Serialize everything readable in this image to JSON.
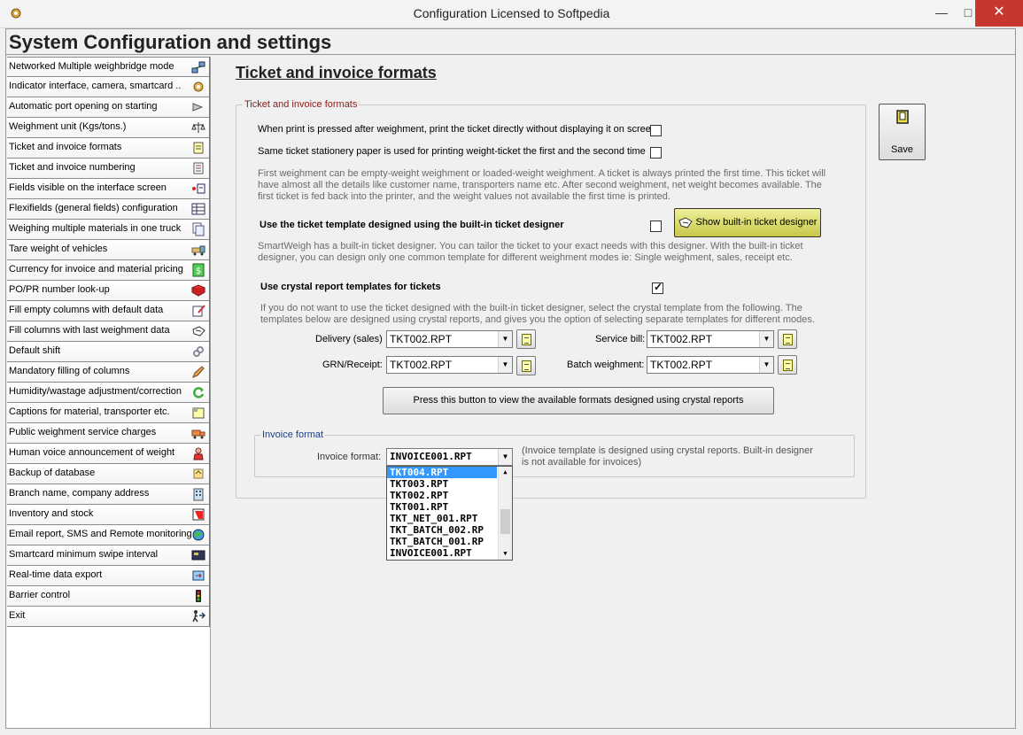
{
  "window": {
    "title": "Configuration  Licensed to Softpedia",
    "minimize": "—",
    "maximize": "□",
    "close": "✕"
  },
  "header": {
    "heading": "System Configuration and settings"
  },
  "sidebar": {
    "items": [
      {
        "label": "Networked Multiple weighbridge mode",
        "icon": "network-icon"
      },
      {
        "label": "Indicator interface, camera, smartcard ..",
        "icon": "gear-icon"
      },
      {
        "label": "Automatic port opening on starting",
        "icon": "plug-icon"
      },
      {
        "label": "Weighment unit (Kgs/tons.)",
        "icon": "scale-icon"
      },
      {
        "label": "Ticket and invoice formats",
        "icon": "document-icon"
      },
      {
        "label": "Ticket and invoice numbering",
        "icon": "numbered-document-icon"
      },
      {
        "label": "Fields visible on the interface screen",
        "icon": "screen-fields-icon"
      },
      {
        "label": "Flexifields (general fields) configuration",
        "icon": "table-icon"
      },
      {
        "label": "Weighing multiple materials in one truck",
        "icon": "documents-icon"
      },
      {
        "label": "Tare weight of vehicles",
        "icon": "truck-icon"
      },
      {
        "label": "Currency for invoice and material pricing",
        "icon": "currency-icon"
      },
      {
        "label": "PO/PR number look-up",
        "icon": "book-icon"
      },
      {
        "label": "Fill empty columns with default data",
        "icon": "edit-icon"
      },
      {
        "label": "Fill columns with last weighment data",
        "icon": "hand-icon"
      },
      {
        "label": "Default shift",
        "icon": "link-icon"
      },
      {
        "label": "Mandatory filling of columns",
        "icon": "pencil-icon"
      },
      {
        "label": "Humidity/wastage adjustment/correction",
        "icon": "refresh-icon"
      },
      {
        "label": "Captions for material, transporter etc.",
        "icon": "caption-icon"
      },
      {
        "label": "Public weighment service charges",
        "icon": "delivery-truck-icon"
      },
      {
        "label": "Human voice announcement of weight",
        "icon": "person-icon"
      },
      {
        "label": "Backup of database",
        "icon": "backup-icon"
      },
      {
        "label": "Branch name, company address",
        "icon": "building-icon"
      },
      {
        "label": "Inventory and stock",
        "icon": "stock-icon"
      },
      {
        "label": "Email report, SMS and Remote monitoring",
        "icon": "globe-icon"
      },
      {
        "label": "Smartcard minimum swipe interval",
        "icon": "card-icon"
      },
      {
        "label": "Real-time data export",
        "icon": "export-icon"
      },
      {
        "label": "Barrier control",
        "icon": "traffic-light-icon"
      },
      {
        "label": "Exit",
        "icon": "exit-icon"
      }
    ]
  },
  "main": {
    "section_title": "Ticket and invoice formats",
    "ticket_group": {
      "legend": "Ticket and invoice formats",
      "print_directly_label": "When print is pressed after weighment, print the ticket directly without displaying it on screen",
      "print_directly_checked": false,
      "same_stationery_label": "Same ticket stationery paper is used for printing weight-ticket the first and the second time",
      "same_stationery_checked": false,
      "first_weighment_text": "First weighment can be empty-weight weighment or loaded-weight weighment. A ticket is always printed the first time. This ticket will have almost all the details like customer name, transporters name etc.  After second weighment, net  weight becomes available. The first ticket is fed back into the printer, and the weight values not available the first time is printed.",
      "builtin_template_label": "Use the ticket template designed using the built-in ticket designer",
      "builtin_template_checked": false,
      "show_designer_button": "Show built-in ticket designer",
      "designer_text": "SmartWeigh has a built-in ticket designer. You can tailor the ticket to your exact needs with this designer. With the built-in ticket designer, you can design only one common template for different weighment modes ie: Single weighment, sales, receipt etc.",
      "crystal_label": "Use crystal report templates for tickets",
      "crystal_checked": true,
      "crystal_text": "If you do not want to use the ticket designed with the built-in ticket designer, select the crystal template from the following.  The templates below are designed using crystal reports, and gives you the option of selecting separate templates for different modes.",
      "delivery_label": "Delivery (sales) :",
      "delivery_value": "TKT002.RPT",
      "service_label": "Service bill:",
      "service_value": "TKT002.RPT",
      "grn_label": "GRN/Receipt:",
      "grn_value": "TKT002.RPT",
      "batch_label": "Batch weighment:",
      "batch_value": "TKT002.RPT",
      "view_formats_button": "Press this button to view the available formats designed using crystal reports"
    },
    "invoice_group": {
      "legend": "Invoice format",
      "format_label": "Invoice format:",
      "format_value": "INVOICE001.RPT",
      "note": "(Invoice template is designed using crystal reports. Built-in designer is not available for invoices)"
    },
    "dropdown": {
      "options": [
        "TKT004.RPT",
        "TKT003.RPT",
        "TKT002.RPT",
        "TKT001.RPT",
        "TKT_NET_001.RPT",
        "TKT_BATCH_002.RP",
        "TKT_BATCH_001.RP",
        "INVOICE001.RPT"
      ],
      "selected": "TKT004.RPT"
    },
    "save_button": "Save"
  },
  "colors": {
    "ticket_legend": "#8b1a1a",
    "invoice_legend": "#1a3f8b",
    "designer_button": "#d8d870",
    "selection": "#3399ff",
    "close_button": "#c7372f"
  }
}
